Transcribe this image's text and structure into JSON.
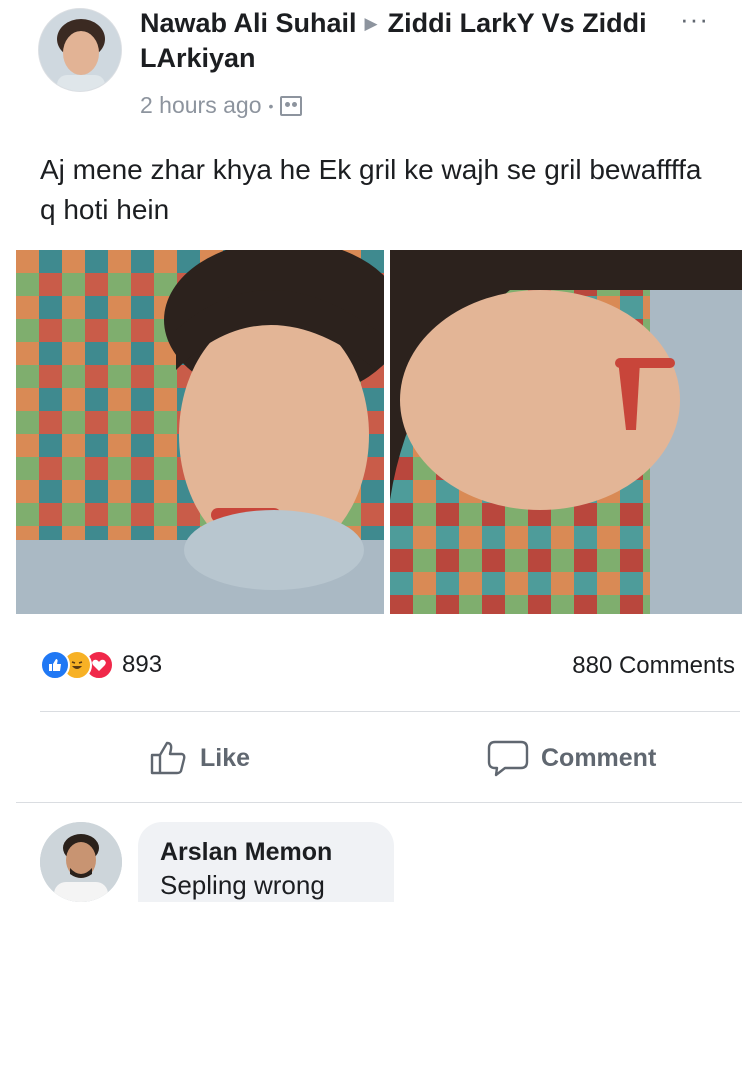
{
  "post": {
    "author": "Nawab Ali Suhail",
    "group": "Ziddi LarkY Vs Ziddi LArkiyan",
    "time": "2 hours ago",
    "separator": "•",
    "text": "Aj mene zhar khya he Ek gril ke wajh se gril bewaffffa q hoti hein",
    "more_icon": "more-dots-icon",
    "audience_icon": "group-audience-icon"
  },
  "reactions": {
    "count": "893",
    "icons": [
      "like-reaction-icon",
      "haha-reaction-icon",
      "love-reaction-icon"
    ],
    "comments_count": "880 Comments"
  },
  "actions": {
    "like_label": "Like",
    "comment_label": "Comment"
  },
  "comment": {
    "author": "Arslan Memon",
    "text": "Sepling wrong"
  },
  "colors": {
    "text": "#1c1e21",
    "muted": "#8d949e",
    "like_blue": "#2078f4",
    "love_red": "#f0284a",
    "haha_yellow": "#f7b125",
    "bubble_bg": "#f0f2f5"
  }
}
